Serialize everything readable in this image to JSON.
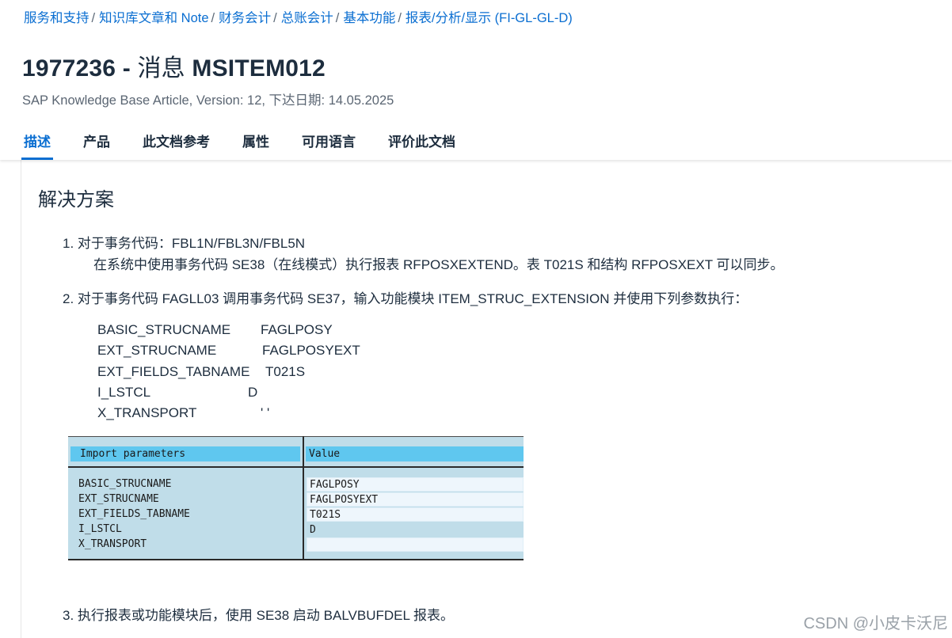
{
  "breadcrumb": [
    "服务和支持",
    "知识库文章和 Note",
    "财务会计",
    "总账会计",
    "基本功能",
    "报表/分析/显示 (FI-GL-GL-D)"
  ],
  "breadcrumb_separator": "/",
  "title": {
    "number": "1977236",
    "dash": " - ",
    "word": "消息 ",
    "code": "MSITEM012"
  },
  "subtitle": "SAP Knowledge Base Article, Version: 12, 下达日期: 14.05.2025",
  "tabs": [
    {
      "label": "描述",
      "active": true
    },
    {
      "label": "产品",
      "active": false
    },
    {
      "label": "此文档参考",
      "active": false
    },
    {
      "label": "属性",
      "active": false
    },
    {
      "label": "可用语言",
      "active": false
    },
    {
      "label": "评价此文档",
      "active": false
    }
  ],
  "section_title": "解决方案",
  "steps": [
    "1. 对于事务代码：FBL1N/FBL3N/FBL5N",
    "在系统中使用事务代码 SE38（在线模式）执行报表 RFPOSXEXTEND。表 T021S 和结构 RFPOSXEXT 可以同步。",
    "2. 对于事务代码 FAGLL03 调用事务代码 SE37，输入功能模块 ITEM_STRUC_EXTENSION 并使用下列参数执行：",
    "3. 执行报表或功能模块后，使用 SE38 启动 BALVBUFDEL 报表。"
  ],
  "params": [
    {
      "name": "BASIC_STRUCNAME",
      "value": "FAGLPOSY"
    },
    {
      "name": "EXT_STRUCNAME",
      "value": "FAGLPOSYEXT"
    },
    {
      "name": "EXT_FIELDS_TABNAME",
      "value": "T021S"
    },
    {
      "name": "I_LSTCL",
      "value": "D"
    },
    {
      "name": "X_TRANSPORT",
      "value": "' '"
    }
  ],
  "sap_table": {
    "header_left": "Import parameters",
    "header_right": "Value",
    "rows": [
      {
        "name": "BASIC_STRUCNAME",
        "value": "FAGLPOSY"
      },
      {
        "name": "EXT_STRUCNAME",
        "value": "FAGLPOSYEXT"
      },
      {
        "name": "EXT_FIELDS_TABNAME",
        "value": "T021S"
      },
      {
        "name": "I_LSTCL",
        "value": "D"
      },
      {
        "name": "X_TRANSPORT",
        "value": ""
      }
    ]
  },
  "watermark": "CSDN @小皮卡沃尼",
  "colors": {
    "link": "#0a6ed1",
    "table_bg": "#c0dde9",
    "table_header": "#5fc7ef",
    "text": "#1d2d3e"
  }
}
